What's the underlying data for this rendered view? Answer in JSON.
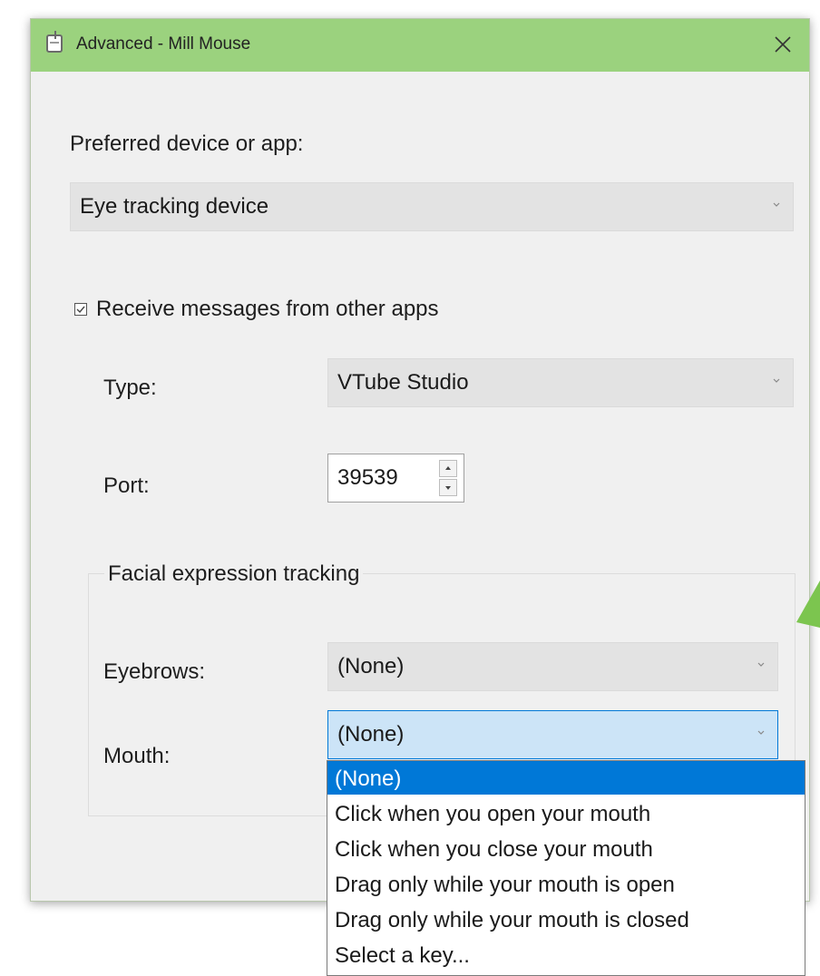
{
  "window": {
    "title": "Advanced - Mill Mouse",
    "icon": "mouse-app-icon",
    "close_icon": "close-icon",
    "titlebar_color": "#9bd27e"
  },
  "preferred": {
    "label": "Preferred device or app:",
    "value": "Eye tracking device"
  },
  "receive_messages": {
    "label": "Receive messages from other apps",
    "checked": true
  },
  "type": {
    "label": "Type:",
    "value": "VTube Studio"
  },
  "port": {
    "label": "Port:",
    "value": "39539"
  },
  "facial": {
    "legend": "Facial expression tracking",
    "eyebrows": {
      "label": "Eyebrows:",
      "value": "(None)"
    },
    "mouth": {
      "label": "Mouth:",
      "value": "(None)",
      "options": [
        "(None)",
        "Click when you open your mouth",
        "Click when you close your mouth",
        "Drag only while your mouth is open",
        "Drag only while your mouth is closed",
        "Select a key..."
      ],
      "selected_index": 0
    }
  },
  "colors": {
    "selection": "#0078d7",
    "active_combo": "#cce4f7"
  }
}
